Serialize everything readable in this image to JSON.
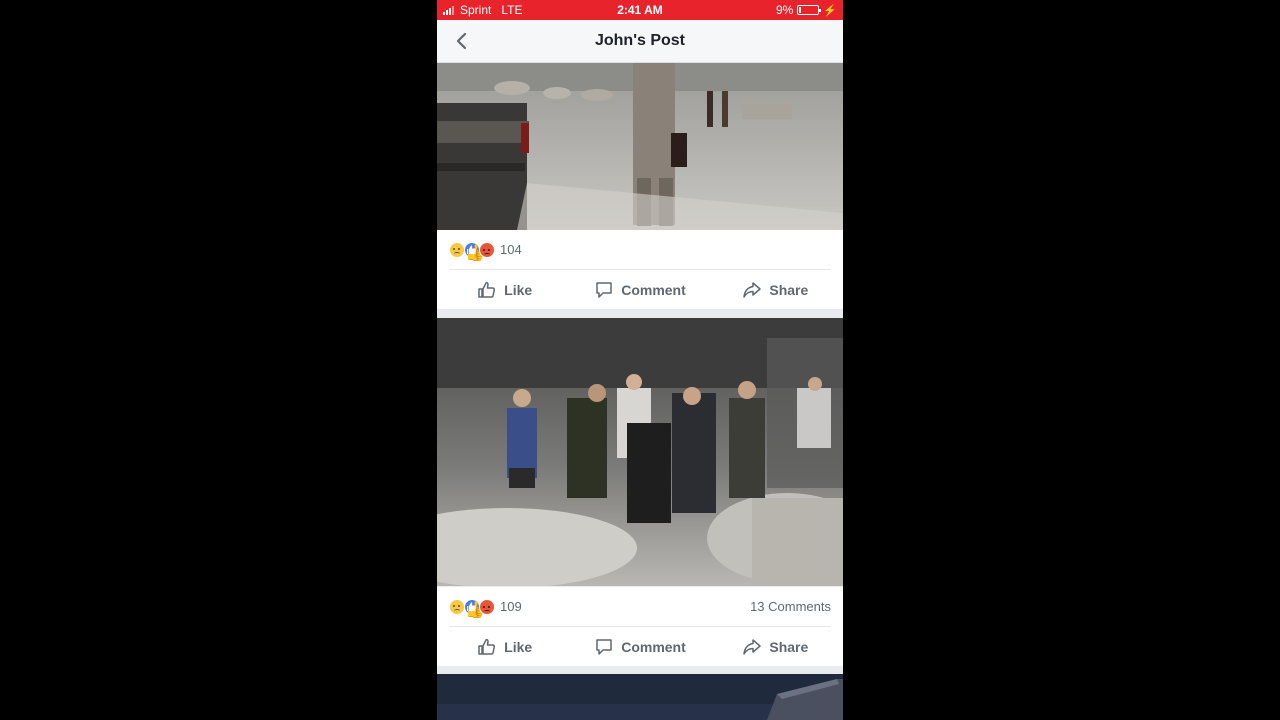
{
  "status_bar": {
    "carrier": "Sprint",
    "network": "LTE",
    "time": "2:41 AM",
    "battery_percent": "9%",
    "battery_level": 0.09,
    "colors": {
      "background": "#e8232b"
    }
  },
  "nav": {
    "back_icon": "chevron-left-icon",
    "title": "John's Post"
  },
  "posts": [
    {
      "photo_alt": "Street covered in dust and debris",
      "reactions": [
        "sad",
        "like",
        "angry"
      ],
      "reaction_count": "104",
      "comments_label": "",
      "actions": {
        "like": "Like",
        "comment": "Comment",
        "share": "Share"
      }
    },
    {
      "photo_alt": "Firefighters carrying a man through debris",
      "reactions": [
        "sad",
        "like",
        "angry"
      ],
      "reaction_count": "109",
      "comments_label": "13 Comments",
      "actions": {
        "like": "Like",
        "comment": "Comment",
        "share": "Share"
      }
    }
  ],
  "colors": {
    "status_bar": "#e8232b",
    "action_text": "#606770",
    "feed_background": "#e9ebee"
  }
}
